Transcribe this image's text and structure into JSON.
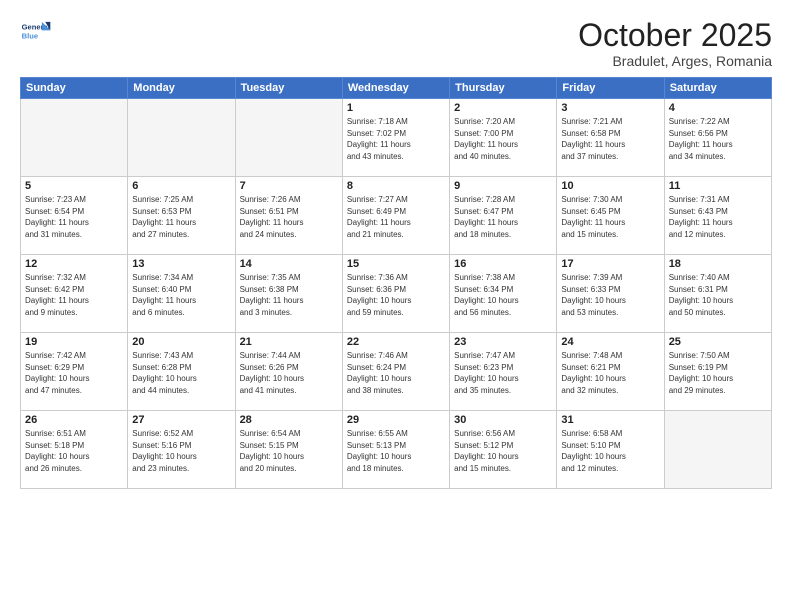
{
  "header": {
    "logo_line1": "General",
    "logo_line2": "Blue",
    "month": "October 2025",
    "location": "Bradulet, Arges, Romania"
  },
  "weekdays": [
    "Sunday",
    "Monday",
    "Tuesday",
    "Wednesday",
    "Thursday",
    "Friday",
    "Saturday"
  ],
  "weeks": [
    [
      {
        "day": "",
        "info": ""
      },
      {
        "day": "",
        "info": ""
      },
      {
        "day": "",
        "info": ""
      },
      {
        "day": "1",
        "info": "Sunrise: 7:18 AM\nSunset: 7:02 PM\nDaylight: 11 hours\nand 43 minutes."
      },
      {
        "day": "2",
        "info": "Sunrise: 7:20 AM\nSunset: 7:00 PM\nDaylight: 11 hours\nand 40 minutes."
      },
      {
        "day": "3",
        "info": "Sunrise: 7:21 AM\nSunset: 6:58 PM\nDaylight: 11 hours\nand 37 minutes."
      },
      {
        "day": "4",
        "info": "Sunrise: 7:22 AM\nSunset: 6:56 PM\nDaylight: 11 hours\nand 34 minutes."
      }
    ],
    [
      {
        "day": "5",
        "info": "Sunrise: 7:23 AM\nSunset: 6:54 PM\nDaylight: 11 hours\nand 31 minutes."
      },
      {
        "day": "6",
        "info": "Sunrise: 7:25 AM\nSunset: 6:53 PM\nDaylight: 11 hours\nand 27 minutes."
      },
      {
        "day": "7",
        "info": "Sunrise: 7:26 AM\nSunset: 6:51 PM\nDaylight: 11 hours\nand 24 minutes."
      },
      {
        "day": "8",
        "info": "Sunrise: 7:27 AM\nSunset: 6:49 PM\nDaylight: 11 hours\nand 21 minutes."
      },
      {
        "day": "9",
        "info": "Sunrise: 7:28 AM\nSunset: 6:47 PM\nDaylight: 11 hours\nand 18 minutes."
      },
      {
        "day": "10",
        "info": "Sunrise: 7:30 AM\nSunset: 6:45 PM\nDaylight: 11 hours\nand 15 minutes."
      },
      {
        "day": "11",
        "info": "Sunrise: 7:31 AM\nSunset: 6:43 PM\nDaylight: 11 hours\nand 12 minutes."
      }
    ],
    [
      {
        "day": "12",
        "info": "Sunrise: 7:32 AM\nSunset: 6:42 PM\nDaylight: 11 hours\nand 9 minutes."
      },
      {
        "day": "13",
        "info": "Sunrise: 7:34 AM\nSunset: 6:40 PM\nDaylight: 11 hours\nand 6 minutes."
      },
      {
        "day": "14",
        "info": "Sunrise: 7:35 AM\nSunset: 6:38 PM\nDaylight: 11 hours\nand 3 minutes."
      },
      {
        "day": "15",
        "info": "Sunrise: 7:36 AM\nSunset: 6:36 PM\nDaylight: 10 hours\nand 59 minutes."
      },
      {
        "day": "16",
        "info": "Sunrise: 7:38 AM\nSunset: 6:34 PM\nDaylight: 10 hours\nand 56 minutes."
      },
      {
        "day": "17",
        "info": "Sunrise: 7:39 AM\nSunset: 6:33 PM\nDaylight: 10 hours\nand 53 minutes."
      },
      {
        "day": "18",
        "info": "Sunrise: 7:40 AM\nSunset: 6:31 PM\nDaylight: 10 hours\nand 50 minutes."
      }
    ],
    [
      {
        "day": "19",
        "info": "Sunrise: 7:42 AM\nSunset: 6:29 PM\nDaylight: 10 hours\nand 47 minutes."
      },
      {
        "day": "20",
        "info": "Sunrise: 7:43 AM\nSunset: 6:28 PM\nDaylight: 10 hours\nand 44 minutes."
      },
      {
        "day": "21",
        "info": "Sunrise: 7:44 AM\nSunset: 6:26 PM\nDaylight: 10 hours\nand 41 minutes."
      },
      {
        "day": "22",
        "info": "Sunrise: 7:46 AM\nSunset: 6:24 PM\nDaylight: 10 hours\nand 38 minutes."
      },
      {
        "day": "23",
        "info": "Sunrise: 7:47 AM\nSunset: 6:23 PM\nDaylight: 10 hours\nand 35 minutes."
      },
      {
        "day": "24",
        "info": "Sunrise: 7:48 AM\nSunset: 6:21 PM\nDaylight: 10 hours\nand 32 minutes."
      },
      {
        "day": "25",
        "info": "Sunrise: 7:50 AM\nSunset: 6:19 PM\nDaylight: 10 hours\nand 29 minutes."
      }
    ],
    [
      {
        "day": "26",
        "info": "Sunrise: 6:51 AM\nSunset: 5:18 PM\nDaylight: 10 hours\nand 26 minutes."
      },
      {
        "day": "27",
        "info": "Sunrise: 6:52 AM\nSunset: 5:16 PM\nDaylight: 10 hours\nand 23 minutes."
      },
      {
        "day": "28",
        "info": "Sunrise: 6:54 AM\nSunset: 5:15 PM\nDaylight: 10 hours\nand 20 minutes."
      },
      {
        "day": "29",
        "info": "Sunrise: 6:55 AM\nSunset: 5:13 PM\nDaylight: 10 hours\nand 18 minutes."
      },
      {
        "day": "30",
        "info": "Sunrise: 6:56 AM\nSunset: 5:12 PM\nDaylight: 10 hours\nand 15 minutes."
      },
      {
        "day": "31",
        "info": "Sunrise: 6:58 AM\nSunset: 5:10 PM\nDaylight: 10 hours\nand 12 minutes."
      },
      {
        "day": "",
        "info": ""
      }
    ]
  ]
}
